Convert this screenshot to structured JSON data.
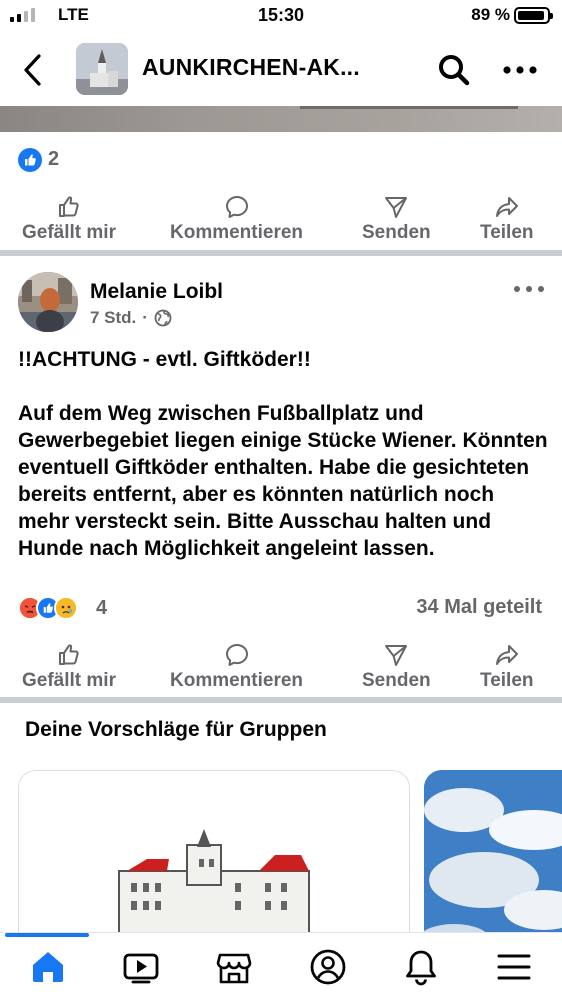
{
  "status_bar": {
    "carrier": "LTE",
    "time": "15:30",
    "battery": "89 %"
  },
  "header": {
    "title": "AUNKIRCHEN-AK...",
    "icons": [
      "back-arrow-icon",
      "search-icon",
      "more-icon"
    ]
  },
  "prev_post": {
    "reaction_count": "2",
    "actions": {
      "like": "Gefällt mir",
      "comment": "Kommentieren",
      "send": "Senden",
      "share": "Teilen"
    }
  },
  "post": {
    "author": "Melanie Loibl",
    "time": "7 Std.",
    "separator": "·",
    "paragraphs": [
      "!!ACHTUNG - evtl. Giftköder!!",
      "Auf dem Weg zwischen Fußballplatz und Gewerbegebiet liegen einige Stücke Wiener. Könnten eventuell Giftköder enthalten. Habe die gesichteten bereits entfernt, aber es könnten natürlich noch mehr versteckt sein. Bitte Ausschau halten und Hunde nach Möglichkeit angeleint lassen."
    ],
    "reaction_count": "4",
    "reactions": [
      "angry",
      "like",
      "sad"
    ],
    "shares": "34 Mal geteilt",
    "actions": {
      "like": "Gefällt mir",
      "comment": "Kommentieren",
      "send": "Senden",
      "share": "Teilen"
    }
  },
  "suggestions": {
    "title": "Deine Vorschläge für Gruppen"
  },
  "bottom_nav": {
    "items": [
      "home-icon",
      "video-icon",
      "marketplace-icon",
      "profile-icon",
      "notifications-icon",
      "menu-icon"
    ],
    "active": "home-icon"
  },
  "colors": {
    "accent": "#1877f2",
    "muted_text": "#65676b",
    "divider": "#c9ccd1"
  }
}
